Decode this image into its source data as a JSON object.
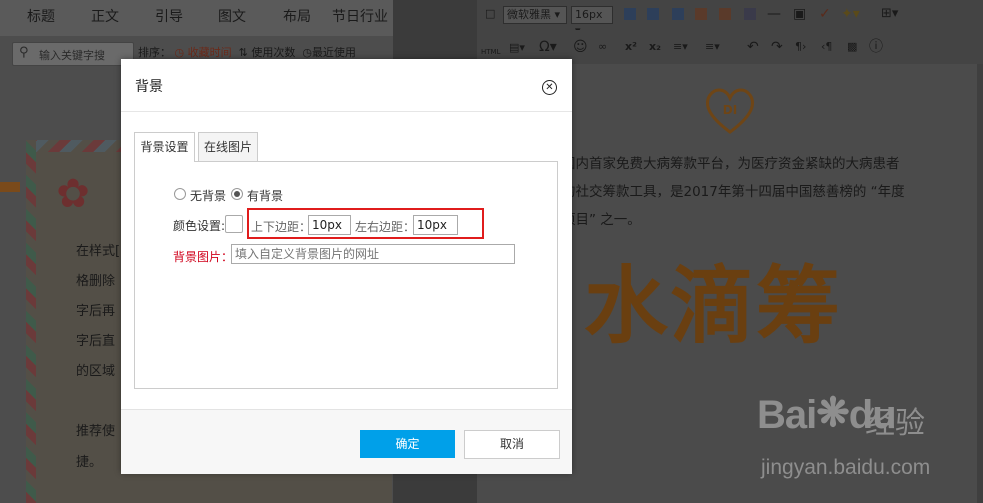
{
  "left_panel": {
    "tabs": [
      "标题",
      "正文",
      "引导",
      "图文",
      "布局",
      "节日行业"
    ],
    "search_placeholder": "输入关键字搜",
    "sort_label": "排序：",
    "sort_options": [
      "收藏时间",
      "使用次数",
      "最近使用"
    ],
    "content_lines": [
      "在样式[",
      "格删除",
      "字后再",
      "字后直",
      "的区域",
      "推荐使",
      "捷。"
    ]
  },
  "editor": {
    "font_family": "微软雅黑",
    "font_size": "16px",
    "doc_lines": [
      "国内首家免费大病筹款平台，为医疗资金紧缺的大病患者",
      "的社交筹款工具，是2017年第十四届中国慈善榜的 “年度",
      "项目” 之一。"
    ],
    "big_title": "水滴筹",
    "logo_mark": "DI"
  },
  "dialog": {
    "title": "背景",
    "close_icon": "close-icon",
    "tabs": [
      {
        "label": "背景设置",
        "active": true
      },
      {
        "label": "在线图片",
        "active": false
      }
    ],
    "radio_no_bg": "无背景",
    "radio_has_bg": "有背景",
    "has_bg_selected": true,
    "color_label": "颜色设置:",
    "v_margin_label": "上下边距：",
    "v_margin_value": "10px",
    "h_margin_label": "左右边距：",
    "h_margin_value": "10px",
    "bg_image_label": "背景图片：",
    "bg_image_placeholder": "填入自定义背景图片的网址",
    "ok_label": "确定",
    "cancel_label": "取消",
    "colors": {
      "primary": "#00a0e9",
      "highlight": "#e01c1c",
      "label_red": "#d0021b"
    }
  },
  "watermark": {
    "brand": "Bai",
    "brand_tail": "du",
    "cn": "经验",
    "url": "jingyan.baidu.com"
  }
}
